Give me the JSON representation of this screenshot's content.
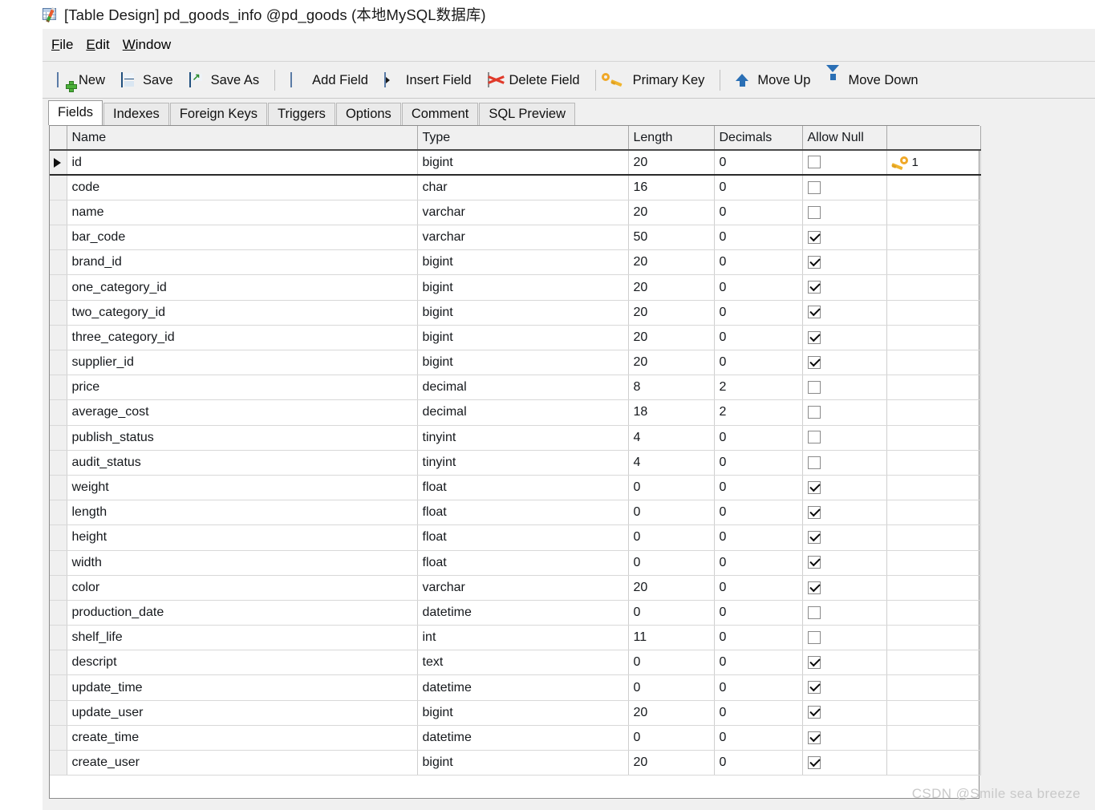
{
  "window": {
    "title": "[Table Design] pd_goods_info @pd_goods (本地MySQL数据库)",
    "title_icon": "table-design-icon"
  },
  "menubar": {
    "items": [
      {
        "label": "File",
        "accel": "F"
      },
      {
        "label": "Edit",
        "accel": "E"
      },
      {
        "label": "Window",
        "accel": "W"
      }
    ]
  },
  "toolbar": {
    "groups": [
      [
        {
          "label": "New",
          "icon": "new-table-icon"
        },
        {
          "label": "Save",
          "icon": "save-icon"
        },
        {
          "label": "Save As",
          "icon": "save-as-icon"
        }
      ],
      [
        {
          "label": "Add Field",
          "icon": "add-field-icon"
        },
        {
          "label": "Insert Field",
          "icon": "insert-field-icon"
        },
        {
          "label": "Delete Field",
          "icon": "delete-field-icon"
        }
      ],
      [
        {
          "label": "Primary Key",
          "icon": "primary-key-icon"
        }
      ],
      [
        {
          "label": "Move Up",
          "icon": "arrow-up-icon"
        },
        {
          "label": "Move Down",
          "icon": "arrow-down-icon"
        }
      ]
    ]
  },
  "tabs": {
    "active": "Fields",
    "items": [
      {
        "label": "Fields"
      },
      {
        "label": "Indexes"
      },
      {
        "label": "Foreign Keys"
      },
      {
        "label": "Triggers"
      },
      {
        "label": "Options"
      },
      {
        "label": "Comment"
      },
      {
        "label": "SQL Preview"
      }
    ]
  },
  "grid": {
    "columns": [
      "Name",
      "Type",
      "Length",
      "Decimals",
      "Allow Null",
      ""
    ],
    "selected_row_index": 0,
    "rows": [
      {
        "name": "id",
        "type": "bigint",
        "length": "20",
        "decimals": "0",
        "allow_null": false,
        "key": "1"
      },
      {
        "name": "code",
        "type": "char",
        "length": "16",
        "decimals": "0",
        "allow_null": false,
        "key": ""
      },
      {
        "name": "name",
        "type": "varchar",
        "length": "20",
        "decimals": "0",
        "allow_null": false,
        "key": ""
      },
      {
        "name": "bar_code",
        "type": "varchar",
        "length": "50",
        "decimals": "0",
        "allow_null": true,
        "key": ""
      },
      {
        "name": "brand_id",
        "type": "bigint",
        "length": "20",
        "decimals": "0",
        "allow_null": true,
        "key": ""
      },
      {
        "name": "one_category_id",
        "type": "bigint",
        "length": "20",
        "decimals": "0",
        "allow_null": true,
        "key": ""
      },
      {
        "name": "two_category_id",
        "type": "bigint",
        "length": "20",
        "decimals": "0",
        "allow_null": true,
        "key": ""
      },
      {
        "name": "three_category_id",
        "type": "bigint",
        "length": "20",
        "decimals": "0",
        "allow_null": true,
        "key": ""
      },
      {
        "name": "supplier_id",
        "type": "bigint",
        "length": "20",
        "decimals": "0",
        "allow_null": true,
        "key": ""
      },
      {
        "name": "price",
        "type": "decimal",
        "length": "8",
        "decimals": "2",
        "allow_null": false,
        "key": ""
      },
      {
        "name": "average_cost",
        "type": "decimal",
        "length": "18",
        "decimals": "2",
        "allow_null": false,
        "key": ""
      },
      {
        "name": "publish_status",
        "type": "tinyint",
        "length": "4",
        "decimals": "0",
        "allow_null": false,
        "key": ""
      },
      {
        "name": "audit_status",
        "type": "tinyint",
        "length": "4",
        "decimals": "0",
        "allow_null": false,
        "key": ""
      },
      {
        "name": "weight",
        "type": "float",
        "length": "0",
        "decimals": "0",
        "allow_null": true,
        "key": ""
      },
      {
        "name": "length",
        "type": "float",
        "length": "0",
        "decimals": "0",
        "allow_null": true,
        "key": ""
      },
      {
        "name": "height",
        "type": "float",
        "length": "0",
        "decimals": "0",
        "allow_null": true,
        "key": ""
      },
      {
        "name": "width",
        "type": "float",
        "length": "0",
        "decimals": "0",
        "allow_null": true,
        "key": ""
      },
      {
        "name": "color",
        "type": "varchar",
        "length": "20",
        "decimals": "0",
        "allow_null": true,
        "key": ""
      },
      {
        "name": "production_date",
        "type": "datetime",
        "length": "0",
        "decimals": "0",
        "allow_null": false,
        "key": ""
      },
      {
        "name": "shelf_life",
        "type": "int",
        "length": "11",
        "decimals": "0",
        "allow_null": false,
        "key": ""
      },
      {
        "name": "descript",
        "type": "text",
        "length": "0",
        "decimals": "0",
        "allow_null": true,
        "key": ""
      },
      {
        "name": "update_time",
        "type": "datetime",
        "length": "0",
        "decimals": "0",
        "allow_null": true,
        "key": ""
      },
      {
        "name": "update_user",
        "type": "bigint",
        "length": "20",
        "decimals": "0",
        "allow_null": true,
        "key": ""
      },
      {
        "name": "create_time",
        "type": "datetime",
        "length": "0",
        "decimals": "0",
        "allow_null": true,
        "key": ""
      },
      {
        "name": "create_user",
        "type": "bigint",
        "length": "20",
        "decimals": "0",
        "allow_null": true,
        "key": ""
      }
    ]
  },
  "watermark": {
    "text": "CSDN @Smile sea breeze"
  },
  "colors": {
    "chrome": "#f0f0f0",
    "grid_header": "#f0f0f0",
    "key_gold": "#f0b42e",
    "icon_blue": "#3f7ab5",
    "watermark": "#c9c9c9"
  }
}
